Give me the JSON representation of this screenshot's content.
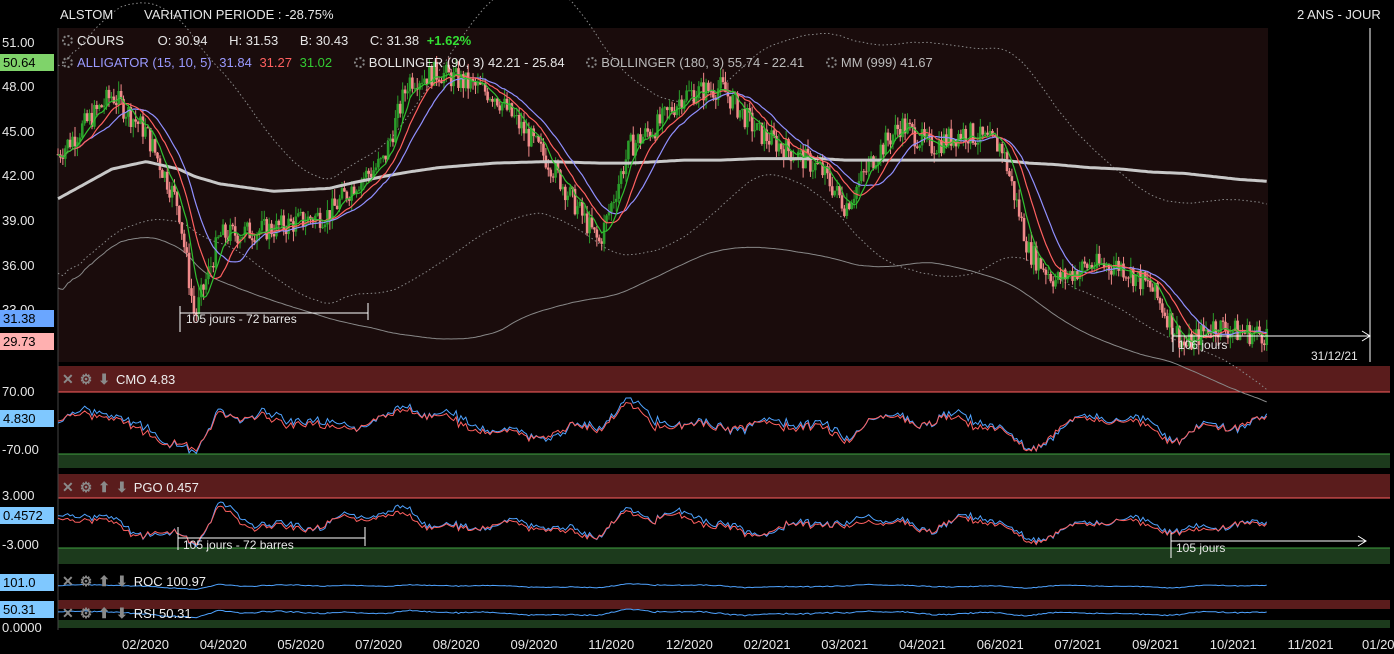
{
  "header": {
    "symbol": "ALSTOM",
    "variation": "VARIATION PERIODE : -28.75%",
    "period": "2 ANS - JOUR"
  },
  "ohlc": {
    "label": "COURS",
    "o": "O: 30.94",
    "h": "H: 31.53",
    "b": "B: 30.43",
    "c": "C: 31.38",
    "change": "+1.62%"
  },
  "indicators": {
    "alligator": {
      "label": "ALLIGATOR (15, 10, 5)",
      "v1": "31.84",
      "v2": "31.27",
      "v3": "31.02"
    },
    "bollinger90": "BOLLINGER (90, 3) 42.21 - 25.84",
    "bollinger180": "BOLLINGER (180, 3) 55.74 - 22.41",
    "mm999": "MM (999) 41.67"
  },
  "colors": {
    "up": "#2a9d2a",
    "down": "#f08a8a",
    "alligator_jaw": "#9090ff",
    "alligator_teeth": "#ff6060",
    "alligator_lips": "#30c030",
    "mm": "#c8c8c8",
    "tag_blue": "#6aa6ff",
    "tag_pink": "#ffb0b0",
    "tag_green": "#7fd36a",
    "tag_cyan": "#7fc8ff"
  },
  "price_axis": [
    "51.00",
    "48.00",
    "45.00",
    "42.00",
    "39.00",
    "36.00",
    "33.00"
  ],
  "price_tags": {
    "alligator_tag": "50.64",
    "close_tag": "31.38",
    "low_tag": "29.73"
  },
  "annotations": {
    "ruler1": "105 jours - 72 barres",
    "ruler2": "106 jours",
    "date_mark": "31/12/21"
  },
  "panels": {
    "cmo": {
      "label": "CMO 4.83",
      "top": "70.00",
      "bottom": "-70.00",
      "tag": "4.830"
    },
    "pgo": {
      "label": "PGO 0.457",
      "top": "3.000",
      "bottom": "-3.000",
      "tag": "0.4572",
      "ruler1": "105 jours - 72 barres",
      "ruler2": "105 jours"
    },
    "roc": {
      "label": "ROC 100.97",
      "tag": "101.0"
    },
    "rsi": {
      "label": "RSI 50.31",
      "tag": "50.31",
      "bottom": "0.0000"
    }
  },
  "x_axis": [
    "02/2020",
    "04/2020",
    "05/2020",
    "07/2020",
    "08/2020",
    "09/2020",
    "11/2020",
    "12/2020",
    "02/2021",
    "03/2021",
    "04/2021",
    "06/2021",
    "07/2021",
    "09/2021",
    "10/2021",
    "11/2021",
    "01/20"
  ],
  "chart_data": {
    "type": "line",
    "title": "ALSTOM",
    "xlabel": "",
    "ylabel": "",
    "ylim": [
      29.5,
      52
    ],
    "x": [
      "2020-01-02",
      "2020-02-01",
      "2020-02-20",
      "2020-03-09",
      "2020-03-18",
      "2020-04-01",
      "2020-05-01",
      "2020-06-01",
      "2020-06-15",
      "2020-07-01",
      "2020-07-15",
      "2020-08-01",
      "2020-09-01",
      "2020-10-01",
      "2020-10-29",
      "2020-11-15",
      "2020-12-01",
      "2020-12-15",
      "2021-01-05",
      "2021-01-25",
      "2021-02-15",
      "2021-03-01",
      "2021-03-15",
      "2021-04-01",
      "2021-04-15",
      "2021-05-01",
      "2021-05-20",
      "2021-06-10",
      "2021-06-25",
      "2021-07-10",
      "2021-07-28",
      "2021-08-15",
      "2021-09-01",
      "2021-09-20",
      "2021-10-05",
      "2021-10-20",
      "2021-11-05"
    ],
    "series": [
      {
        "name": "COURS",
        "values": [
          43.5,
          47.5,
          45.0,
          40.0,
          32.5,
          38.0,
          38.5,
          39.5,
          41.5,
          43.0,
          48.5,
          49.0,
          47.5,
          43.0,
          37.5,
          44.0,
          45.5,
          47.5,
          48.0,
          45.0,
          43.5,
          42.5,
          40.0,
          43.5,
          45.5,
          44.0,
          45.0,
          44.0,
          37.0,
          35.0,
          36.0,
          36.0,
          34.5,
          30.5,
          32.0,
          31.5,
          31.38
        ]
      },
      {
        "name": "MM (999) 41.67",
        "values": [
          40.5,
          42.5,
          43.0,
          42.5,
          42.0,
          41.5,
          41.0,
          41.2,
          41.6,
          42.0,
          42.3,
          42.6,
          42.9,
          43.0,
          42.9,
          42.9,
          43.0,
          43.1,
          43.1,
          43.2,
          43.2,
          43.2,
          43.1,
          43.1,
          43.1,
          43.1,
          43.1,
          43.1,
          42.9,
          42.8,
          42.6,
          42.5,
          42.3,
          42.2,
          42.0,
          41.8,
          41.67
        ]
      }
    ],
    "panels": [
      {
        "name": "CMO 4.83",
        "ylim": [
          -70,
          70
        ]
      },
      {
        "name": "PGO 0.457",
        "ylim": [
          -3,
          3
        ]
      },
      {
        "name": "ROC 100.97"
      },
      {
        "name": "RSI 50.31"
      }
    ]
  }
}
